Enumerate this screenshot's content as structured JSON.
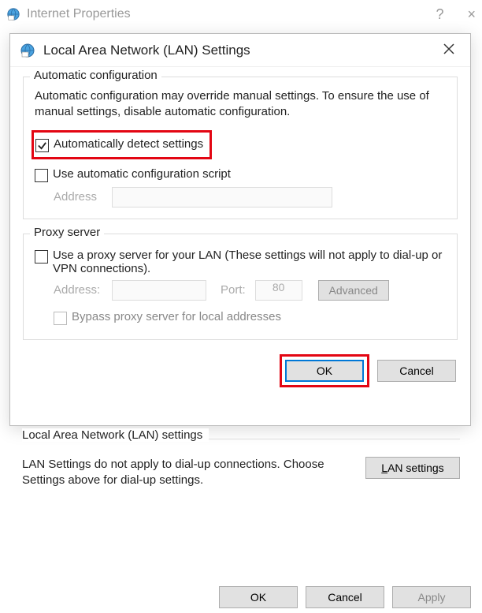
{
  "parent": {
    "title": "Internet Properties",
    "help_symbol": "?",
    "close_symbol": "×",
    "buttons": {
      "ok": "OK",
      "cancel": "Cancel",
      "apply": "Apply"
    }
  },
  "lan": {
    "title": "Local Area Network (LAN) Settings",
    "close_symbol": "×",
    "auto": {
      "legend": "Automatic configuration",
      "desc": "Automatic configuration may override manual settings.  To ensure the use of manual settings, disable automatic configuration.",
      "detect_label": "Automatically detect settings",
      "detect_checked": true,
      "script_label": "Use automatic configuration script",
      "script_checked": false,
      "address_label": "Address"
    },
    "proxy": {
      "legend": "Proxy server",
      "use_label": "Use a proxy server for your LAN (These settings will not apply to dial-up or VPN connections).",
      "use_checked": false,
      "address_label": "Address:",
      "port_label": "Port:",
      "port_value": "80",
      "advanced_label": "Advanced",
      "bypass_label": "Bypass proxy server for local addresses",
      "bypass_checked": false
    },
    "buttons": {
      "ok": "OK",
      "cancel": "Cancel"
    }
  },
  "bottom_section": {
    "legend": "Local Area Network (LAN) settings",
    "text": "LAN Settings do not apply to dial-up connections. Choose Settings above for dial-up settings.",
    "button": "LAN settings"
  }
}
